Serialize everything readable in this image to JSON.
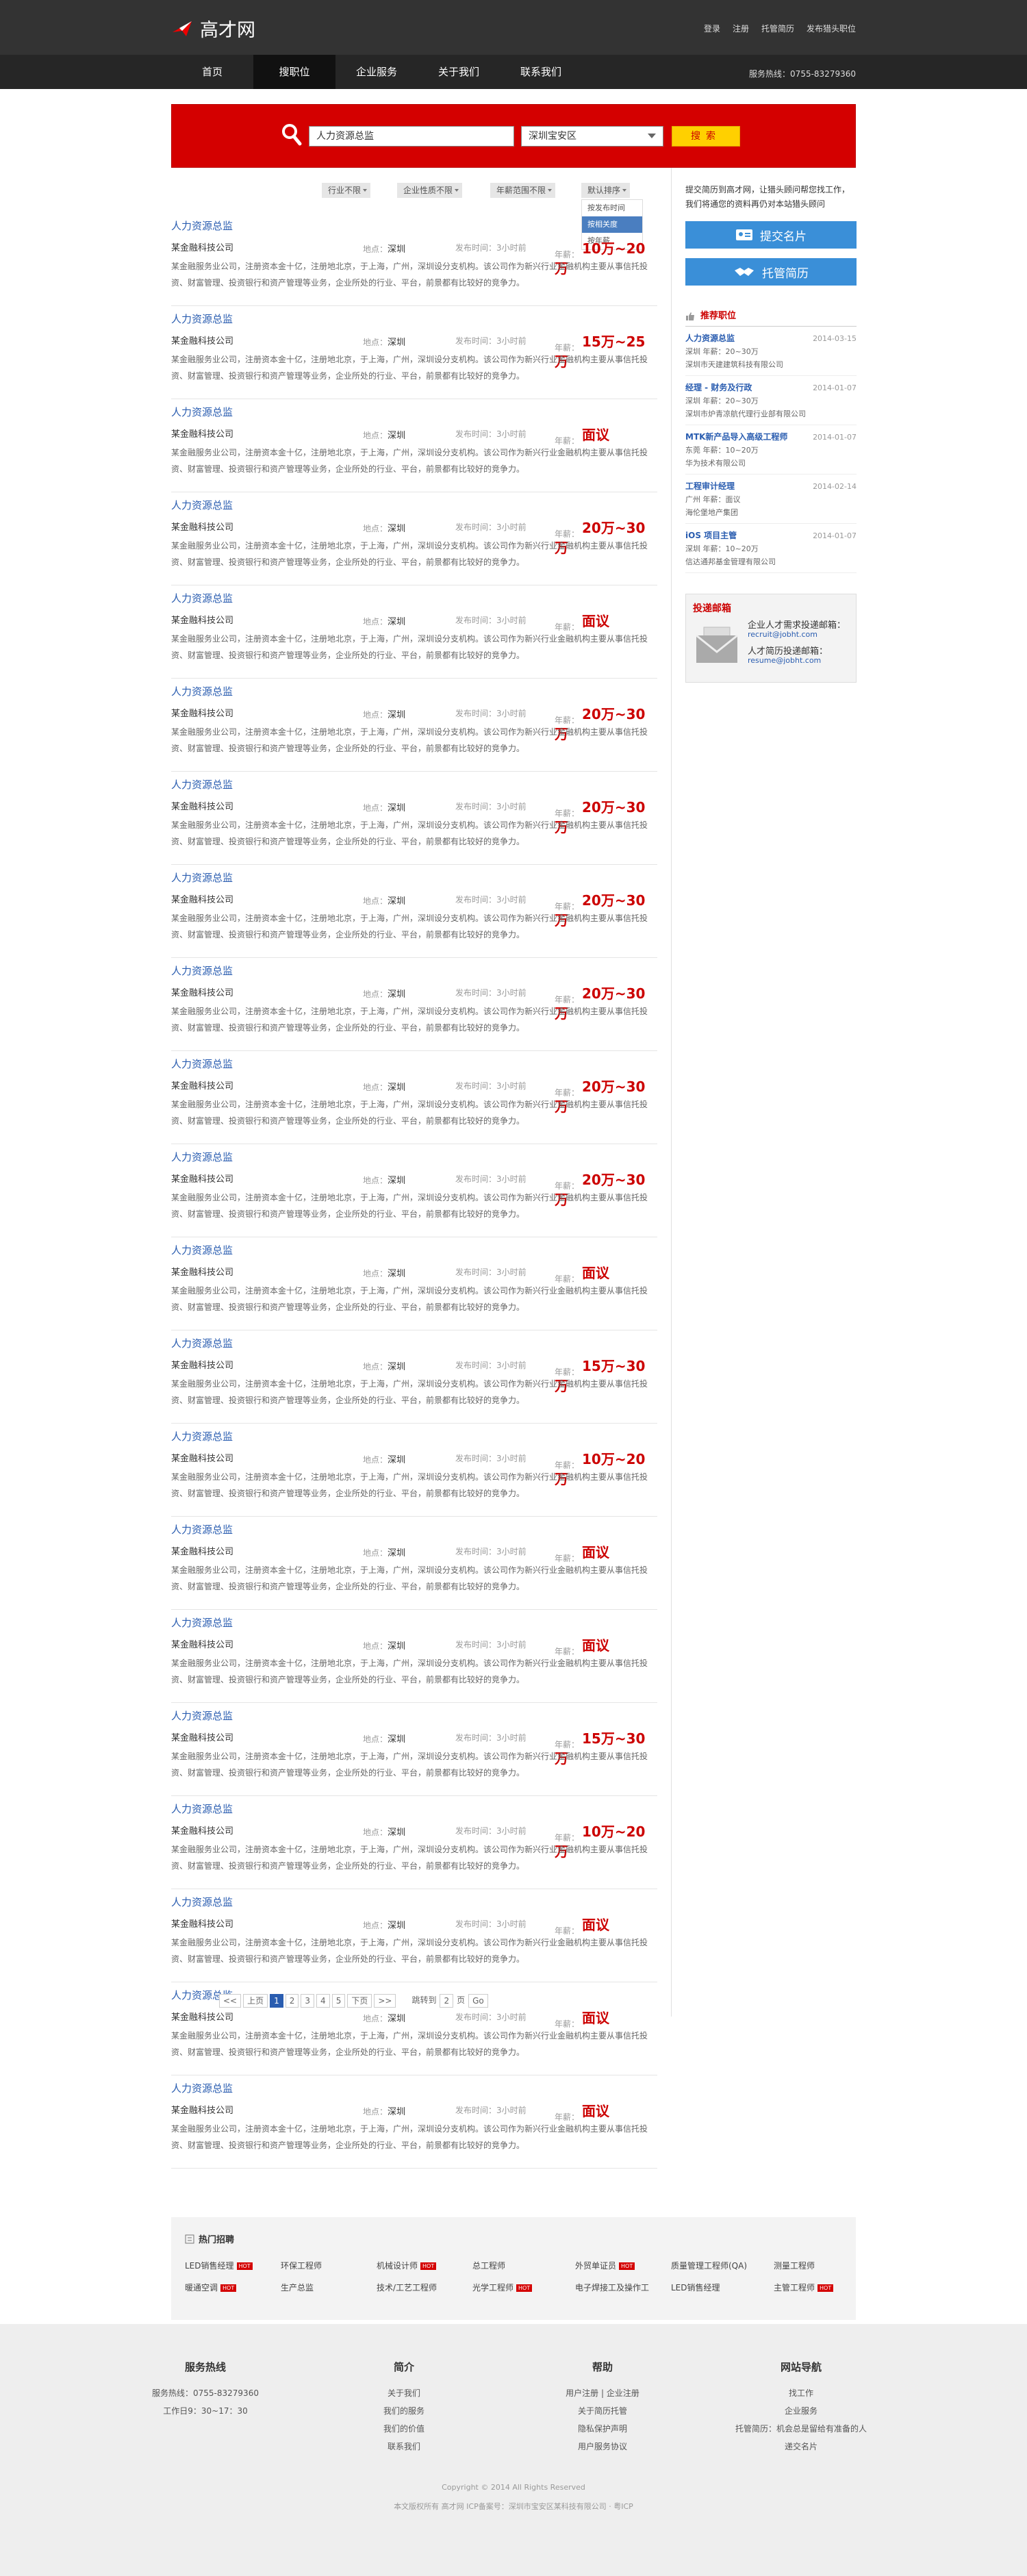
{
  "header": {
    "logo_text": "高才网",
    "links": [
      "登录",
      "注册",
      "托管简历",
      "发布猎头职位"
    ]
  },
  "nav": {
    "items": [
      "首页",
      "搜职位",
      "企业服务",
      "关于我们",
      "联系我们"
    ],
    "active_index": 1,
    "hotline": "服务热线：0755-83279360"
  },
  "search": {
    "keyword": "人力资源总监",
    "location": "深圳宝安区",
    "button": "搜索"
  },
  "filters": {
    "industry": "行业不限",
    "company_type": "企业性质不限",
    "salary": "年薪范围不限",
    "sort": "默认排序",
    "sort_options": [
      "按发布时间",
      "按相关度",
      "按年薪"
    ],
    "sort_selected": 1
  },
  "jobs": [
    {
      "title": "人力资源总监",
      "company": "某金融科技公司",
      "loc_label": "地点：",
      "location": "深圳",
      "time": "发布时间：3小时前",
      "salary_label": "年薪：",
      "salary": "10万~20万",
      "desc": "某金融服务业公司，注册资本金十亿，注册地北京，于上海，广州，深圳设分支机构。该公司作为新兴行业金融机构主要从事信托投资、财富管理、投资银行和资产管理等业务，企业所处的行业、平台，前景都有比较好的竞争力。"
    },
    {
      "title": "人力资源总监",
      "company": "某金融科技公司",
      "loc_label": "地点：",
      "location": "深圳",
      "time": "发布时间：3小时前",
      "salary_label": "年薪：",
      "salary": "15万~25万",
      "desc": "某金融服务业公司，注册资本金十亿，注册地北京，于上海，广州，深圳设分支机构。该公司作为新兴行业金融机构主要从事信托投资、财富管理、投资银行和资产管理等业务，企业所处的行业、平台，前景都有比较好的竞争力。"
    },
    {
      "title": "人力资源总监",
      "company": "某金融科技公司",
      "loc_label": "地点：",
      "location": "深圳",
      "time": "发布时间：3小时前",
      "salary_label": "年薪：",
      "salary": "面议",
      "desc": "某金融服务业公司，注册资本金十亿，注册地北京，于上海，广州，深圳设分支机构。该公司作为新兴行业金融机构主要从事信托投资、财富管理、投资银行和资产管理等业务，企业所处的行业、平台，前景都有比较好的竞争力。"
    },
    {
      "title": "人力资源总监",
      "company": "某金融科技公司",
      "loc_label": "地点：",
      "location": "深圳",
      "time": "发布时间：3小时前",
      "salary_label": "年薪：",
      "salary": "20万~30万",
      "desc": "某金融服务业公司，注册资本金十亿，注册地北京，于上海，广州，深圳设分支机构。该公司作为新兴行业金融机构主要从事信托投资、财富管理、投资银行和资产管理等业务，企业所处的行业、平台，前景都有比较好的竞争力。"
    },
    {
      "title": "人力资源总监",
      "company": "某金融科技公司",
      "loc_label": "地点：",
      "location": "深圳",
      "time": "发布时间：3小时前",
      "salary_label": "年薪：",
      "salary": "面议",
      "desc": "某金融服务业公司，注册资本金十亿，注册地北京，于上海，广州，深圳设分支机构。该公司作为新兴行业金融机构主要从事信托投资、财富管理、投资银行和资产管理等业务，企业所处的行业、平台，前景都有比较好的竞争力。"
    },
    {
      "title": "人力资源总监",
      "company": "某金融科技公司",
      "loc_label": "地点：",
      "location": "深圳",
      "time": "发布时间：3小时前",
      "salary_label": "年薪：",
      "salary": "20万~30万",
      "desc": "某金融服务业公司，注册资本金十亿，注册地北京，于上海，广州，深圳设分支机构。该公司作为新兴行业金融机构主要从事信托投资、财富管理、投资银行和资产管理等业务，企业所处的行业、平台，前景都有比较好的竞争力。"
    },
    {
      "title": "人力资源总监",
      "company": "某金融科技公司",
      "loc_label": "地点：",
      "location": "深圳",
      "time": "发布时间：3小时前",
      "salary_label": "年薪：",
      "salary": "20万~30万",
      "desc": "某金融服务业公司，注册资本金十亿，注册地北京，于上海，广州，深圳设分支机构。该公司作为新兴行业金融机构主要从事信托投资、财富管理、投资银行和资产管理等业务，企业所处的行业、平台，前景都有比较好的竞争力。"
    },
    {
      "title": "人力资源总监",
      "company": "某金融科技公司",
      "loc_label": "地点：",
      "location": "深圳",
      "time": "发布时间：3小时前",
      "salary_label": "年薪：",
      "salary": "20万~30万",
      "desc": "某金融服务业公司，注册资本金十亿，注册地北京，于上海，广州，深圳设分支机构。该公司作为新兴行业金融机构主要从事信托投资、财富管理、投资银行和资产管理等业务，企业所处的行业、平台，前景都有比较好的竞争力。"
    },
    {
      "title": "人力资源总监",
      "company": "某金融科技公司",
      "loc_label": "地点：",
      "location": "深圳",
      "time": "发布时间：3小时前",
      "salary_label": "年薪：",
      "salary": "20万~30万",
      "desc": "某金融服务业公司，注册资本金十亿，注册地北京，于上海，广州，深圳设分支机构。该公司作为新兴行业金融机构主要从事信托投资、财富管理、投资银行和资产管理等业务，企业所处的行业、平台，前景都有比较好的竞争力。"
    },
    {
      "title": "人力资源总监",
      "company": "某金融科技公司",
      "loc_label": "地点：",
      "location": "深圳",
      "time": "发布时间：3小时前",
      "salary_label": "年薪：",
      "salary": "20万~30万",
      "desc": "某金融服务业公司，注册资本金十亿，注册地北京，于上海，广州，深圳设分支机构。该公司作为新兴行业金融机构主要从事信托投资、财富管理、投资银行和资产管理等业务，企业所处的行业、平台，前景都有比较好的竞争力。"
    },
    {
      "title": "人力资源总监",
      "company": "某金融科技公司",
      "loc_label": "地点：",
      "location": "深圳",
      "time": "发布时间：3小时前",
      "salary_label": "年薪：",
      "salary": "20万~30万",
      "desc": "某金融服务业公司，注册资本金十亿，注册地北京，于上海，广州，深圳设分支机构。该公司作为新兴行业金融机构主要从事信托投资、财富管理、投资银行和资产管理等业务，企业所处的行业、平台，前景都有比较好的竞争力。"
    },
    {
      "title": "人力资源总监",
      "company": "某金融科技公司",
      "loc_label": "地点：",
      "location": "深圳",
      "time": "发布时间：3小时前",
      "salary_label": "年薪：",
      "salary": "面议",
      "desc": "某金融服务业公司，注册资本金十亿，注册地北京，于上海，广州，深圳设分支机构。该公司作为新兴行业金融机构主要从事信托投资、财富管理、投资银行和资产管理等业务，企业所处的行业、平台，前景都有比较好的竞争力。"
    },
    {
      "title": "人力资源总监",
      "company": "某金融科技公司",
      "loc_label": "地点：",
      "location": "深圳",
      "time": "发布时间：3小时前",
      "salary_label": "年薪：",
      "salary": "15万~30万",
      "desc": "某金融服务业公司，注册资本金十亿，注册地北京，于上海，广州，深圳设分支机构。该公司作为新兴行业金融机构主要从事信托投资、财富管理、投资银行和资产管理等业务，企业所处的行业、平台，前景都有比较好的竞争力。"
    },
    {
      "title": "人力资源总监",
      "company": "某金融科技公司",
      "loc_label": "地点：",
      "location": "深圳",
      "time": "发布时间：3小时前",
      "salary_label": "年薪：",
      "salary": "10万~20万",
      "desc": "某金融服务业公司，注册资本金十亿，注册地北京，于上海，广州，深圳设分支机构。该公司作为新兴行业金融机构主要从事信托投资、财富管理、投资银行和资产管理等业务，企业所处的行业、平台，前景都有比较好的竞争力。"
    },
    {
      "title": "人力资源总监",
      "company": "某金融科技公司",
      "loc_label": "地点：",
      "location": "深圳",
      "time": "发布时间：3小时前",
      "salary_label": "年薪：",
      "salary": "面议",
      "desc": "某金融服务业公司，注册资本金十亿，注册地北京，于上海，广州，深圳设分支机构。该公司作为新兴行业金融机构主要从事信托投资、财富管理、投资银行和资产管理等业务，企业所处的行业、平台，前景都有比较好的竞争力。"
    },
    {
      "title": "人力资源总监",
      "company": "某金融科技公司",
      "loc_label": "地点：",
      "location": "深圳",
      "time": "发布时间：3小时前",
      "salary_label": "年薪：",
      "salary": "面议",
      "desc": "某金融服务业公司，注册资本金十亿，注册地北京，于上海，广州，深圳设分支机构。该公司作为新兴行业金融机构主要从事信托投资、财富管理、投资银行和资产管理等业务，企业所处的行业、平台，前景都有比较好的竞争力。"
    },
    {
      "title": "人力资源总监",
      "company": "某金融科技公司",
      "loc_label": "地点：",
      "location": "深圳",
      "time": "发布时间：3小时前",
      "salary_label": "年薪：",
      "salary": "15万~30万",
      "desc": "某金融服务业公司，注册资本金十亿，注册地北京，于上海，广州，深圳设分支机构。该公司作为新兴行业金融机构主要从事信托投资、财富管理、投资银行和资产管理等业务，企业所处的行业、平台，前景都有比较好的竞争力。"
    },
    {
      "title": "人力资源总监",
      "company": "某金融科技公司",
      "loc_label": "地点：",
      "location": "深圳",
      "time": "发布时间：3小时前",
      "salary_label": "年薪：",
      "salary": "10万~20万",
      "desc": "某金融服务业公司，注册资本金十亿，注册地北京，于上海，广州，深圳设分支机构。该公司作为新兴行业金融机构主要从事信托投资、财富管理、投资银行和资产管理等业务，企业所处的行业、平台，前景都有比较好的竞争力。"
    },
    {
      "title": "人力资源总监",
      "company": "某金融科技公司",
      "loc_label": "地点：",
      "location": "深圳",
      "time": "发布时间：3小时前",
      "salary_label": "年薪：",
      "salary": "面议",
      "desc": "某金融服务业公司，注册资本金十亿，注册地北京，于上海，广州，深圳设分支机构。该公司作为新兴行业金融机构主要从事信托投资、财富管理、投资银行和资产管理等业务，企业所处的行业、平台，前景都有比较好的竞争力。"
    },
    {
      "title": "人力资源总监",
      "company": "某金融科技公司",
      "loc_label": "地点：",
      "location": "深圳",
      "time": "发布时间：3小时前",
      "salary_label": "年薪：",
      "salary": "面议",
      "desc": "某金融服务业公司，注册资本金十亿，注册地北京，于上海，广州，深圳设分支机构。该公司作为新兴行业金融机构主要从事信托投资、财富管理、投资银行和资产管理等业务，企业所处的行业、平台，前景都有比较好的竞争力。"
    },
    {
      "title": "人力资源总监",
      "company": "某金融科技公司",
      "loc_label": "地点：",
      "location": "深圳",
      "time": "发布时间：3小时前",
      "salary_label": "年薪：",
      "salary": "面议",
      "desc": "某金融服务业公司，注册资本金十亿，注册地北京，于上海，广州，深圳设分支机构。该公司作为新兴行业金融机构主要从事信托投资、财富管理、投资银行和资产管理等业务，企业所处的行业、平台，前景都有比较好的竞争力。"
    }
  ],
  "pager": {
    "first": "<<",
    "prev": "上页",
    "pages": [
      "1",
      "2",
      "3",
      "4",
      "5"
    ],
    "current": 0,
    "next": "下页",
    "last": ">>",
    "jump_label": "跳转到",
    "jump_value": "2",
    "page_unit": "页",
    "go": "Go"
  },
  "sidebar": {
    "promo": "提交简历到高才网，让猎头顾问帮您找工作，我们将通您的资料再仍对本站猎头顾问",
    "submit_card": "提交名片",
    "host_resume": "托管简历",
    "rec_title": "推荐职位",
    "rec_jobs": [
      {
        "title": "人力资源总监",
        "date": "2014-03-15",
        "meta": "深圳    年薪：20~30万",
        "company": "深圳市天建建筑科技有限公司"
      },
      {
        "title": "经理 - 财务及行政",
        "date": "2014-01-07",
        "meta": "深圳    年薪：20~30万",
        "company": "深圳市炉青凉航代理行业部有限公司"
      },
      {
        "title": "MTK新产品导入高级工程师",
        "date": "2014-01-07",
        "meta": "东莞    年薪：10~20万",
        "company": "华为技术有限公司"
      },
      {
        "title": "工程审计经理",
        "date": "2014-02-14",
        "meta": "广州    年薪：面议",
        "company": "海伦堡地产集团"
      },
      {
        "title": "iOS 项目主管",
        "date": "2014-01-07",
        "meta": "深圳    年薪：10~20万",
        "company": "信达通邦基金管理有限公司"
      }
    ],
    "mail": {
      "title": "投递邮箱",
      "enterprise_label": "企业人才需求投递邮箱：",
      "enterprise_email": "recruit@jobht.com",
      "resume_label": "人才简历投递邮箱：",
      "resume_email": "resume@jobht.com"
    }
  },
  "hot": {
    "title": "热门招聘",
    "items": [
      {
        "label": "LED销售经理",
        "hot": true
      },
      {
        "label": "环保工程师",
        "hot": false
      },
      {
        "label": "机械设计师",
        "hot": true
      },
      {
        "label": "总工程师",
        "hot": false
      },
      {
        "label": "外贸单证员",
        "hot": true
      },
      {
        "label": "质量管理工程师(QA)",
        "hot": false
      },
      {
        "label": "测量工程师",
        "hot": false
      },
      {
        "label": "暖通空调",
        "hot": true
      },
      {
        "label": "生产总监",
        "hot": false
      },
      {
        "label": "技术/工艺工程师",
        "hot": false
      },
      {
        "label": "光学工程师",
        "hot": true
      },
      {
        "label": "电子焊接工及操作工",
        "hot": false
      },
      {
        "label": "LED销售经理",
        "hot": false
      },
      {
        "label": "主管工程师",
        "hot": true
      }
    ],
    "tag": "HOT"
  },
  "footer": {
    "cols": [
      {
        "title": "服务热线",
        "lines": [
          "服务热线：0755-83279360",
          "工作日9：30~17：30"
        ]
      },
      {
        "title": "简介",
        "lines": [
          "关于我们",
          "我们的服务",
          "我们的价值",
          "联系我们"
        ]
      },
      {
        "title": "帮助",
        "lines": [
          "用户注册 | 企业注册",
          "关于简历托管",
          "隐私保护声明",
          "用户服务协议"
        ]
      },
      {
        "title": "网站导航",
        "lines": [
          "找工作",
          "企业服务",
          "托管简历：机会总是留给有准备的人",
          "递交名片"
        ]
      }
    ],
    "copyright": "Copyright © 2014 All Rights Reserved",
    "icp": "本文版权所有 高才网 ICP备案号：深圳市宝安区某科技有限公司 · 粤ICP"
  }
}
